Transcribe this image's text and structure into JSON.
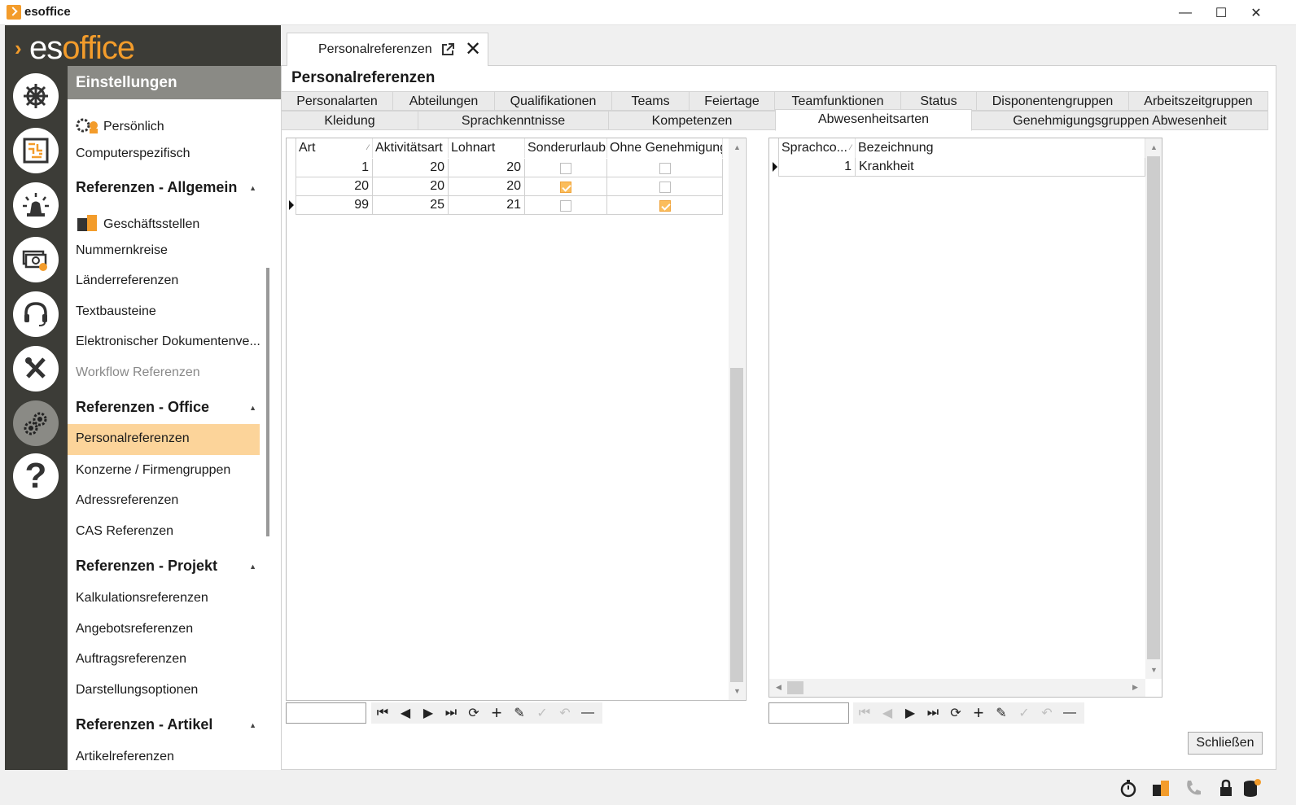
{
  "window": {
    "title": "esoffice",
    "minimize": "—",
    "maximize": "☐",
    "close": "✕"
  },
  "brand": {
    "part1": "es",
    "part2": "office"
  },
  "rail": [
    {
      "name": "dashboard-helm-icon"
    },
    {
      "name": "planner-board-icon"
    },
    {
      "name": "alarm-light-icon"
    },
    {
      "name": "finance-money-icon"
    },
    {
      "name": "support-headset-icon"
    },
    {
      "name": "tools-icon"
    },
    {
      "name": "settings-gears-icon"
    },
    {
      "name": "help-icon",
      "glyph": "?"
    }
  ],
  "nav": {
    "header": "Einstellungen",
    "items": [
      {
        "label": "Persönlich"
      },
      {
        "label": "Computerspezifisch"
      },
      {
        "label": "Referenzen - Allgemein",
        "group": true
      },
      {
        "label": "Geschäftsstellen"
      },
      {
        "label": "Nummernkreise"
      },
      {
        "label": "Länderreferenzen"
      },
      {
        "label": "Textbausteine"
      },
      {
        "label": "Elektronischer Dokumentenve..."
      },
      {
        "label": "Workflow Referenzen",
        "disabled": true
      },
      {
        "label": "Referenzen - Office",
        "group": true
      },
      {
        "label": "Personalreferenzen",
        "selected": true
      },
      {
        "label": "Konzerne / Firmengruppen"
      },
      {
        "label": "Adressreferenzen"
      },
      {
        "label": "CAS Referenzen"
      },
      {
        "label": "Referenzen - Projekt",
        "group": true
      },
      {
        "label": "Kalkulationsreferenzen"
      },
      {
        "label": "Angebotsreferenzen"
      },
      {
        "label": "Auftragsreferenzen"
      },
      {
        "label": "Darstellungsoptionen"
      },
      {
        "label": "Referenzen - Artikel",
        "group": true
      },
      {
        "label": "Artikelreferenzen"
      }
    ]
  },
  "doc_tab": {
    "label": "Personalreferenzen"
  },
  "page_title": "Personalreferenzen",
  "tabs_row1": [
    "Personalarten",
    "Abteilungen",
    "Qualifikationen",
    "Teams",
    "Feiertage",
    "Teamfunktionen",
    "Status",
    "Disponentengruppen",
    "Arbeitszeitgruppen"
  ],
  "tabs_row2": [
    "Kleidung",
    "Sprachkenntnisse",
    "Kompetenzen",
    "Abwesenheitsarten",
    "Genehmigungsgruppen Abwesenheit"
  ],
  "active_tab": "Abwesenheitsarten",
  "grid1": {
    "columns": [
      "Art",
      "Aktivitätsart",
      "Lohnart",
      "Sonderurlaub",
      "Ohne Genehmigung"
    ],
    "rows": [
      {
        "art": "1",
        "aktivitaet": "20",
        "lohnart": "20",
        "sonderurlaub": false,
        "ohne": false
      },
      {
        "art": "20",
        "aktivitaet": "20",
        "lohnart": "20",
        "sonderurlaub": true,
        "ohne": false
      },
      {
        "art": "99",
        "aktivitaet": "25",
        "lohnart": "21",
        "sonderurlaub": false,
        "ohne": true
      }
    ],
    "current_row": 2
  },
  "grid2": {
    "columns": [
      "Sprachco...",
      "Bezeichnung"
    ],
    "rows": [
      {
        "code": "1",
        "bezeichnung": "Krankheit"
      }
    ],
    "current_row": 0
  },
  "navbar": {
    "buttons": [
      {
        "name": "first-record-icon",
        "glyph": "⏮"
      },
      {
        "name": "prev-record-icon",
        "glyph": "◀"
      },
      {
        "name": "next-record-icon",
        "glyph": "▶"
      },
      {
        "name": "last-record-icon",
        "glyph": "⏭"
      },
      {
        "name": "refresh-icon",
        "glyph": "⟳"
      },
      {
        "name": "add-icon",
        "glyph": "+"
      },
      {
        "name": "edit-pencil-icon",
        "glyph": "✎"
      },
      {
        "name": "confirm-check-icon",
        "glyph": "✓"
      },
      {
        "name": "undo-icon",
        "glyph": "↶"
      },
      {
        "name": "delete-minus-icon",
        "glyph": "—"
      }
    ]
  },
  "close_button": "Schließen",
  "colors": {
    "accent": "#f39c2b",
    "selected": "#fcd49a",
    "dark": "#3c3c37"
  }
}
